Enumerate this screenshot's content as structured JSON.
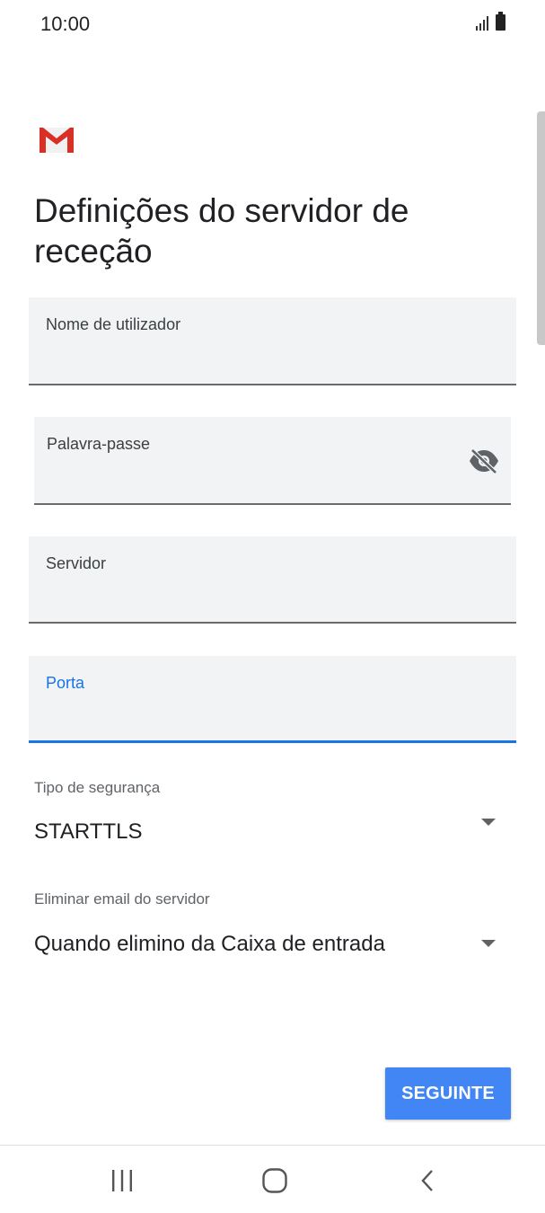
{
  "status_bar": {
    "time": "10:00"
  },
  "app": {
    "logo": "gmail-logo"
  },
  "page": {
    "title": "Definições do servidor de receção"
  },
  "fields": {
    "username": {
      "label": "Nome de utilizador",
      "value": ""
    },
    "password": {
      "label": "Palavra-passe",
      "value": ""
    },
    "server": {
      "label": "Servidor",
      "value": ""
    },
    "port": {
      "label": "Porta",
      "value": ""
    }
  },
  "security": {
    "label": "Tipo de segurança",
    "value": "STARTTLS"
  },
  "delete_email": {
    "label": "Eliminar email do servidor",
    "value": "Quando elimino da Caixa de entrada"
  },
  "next_button": {
    "label": "SEGUINTE"
  },
  "colors": {
    "accent": "#1a73e8",
    "button": "#4285f4",
    "field_bg": "#f1f3f4",
    "gmail_red": "#d93025"
  },
  "nav_icons": [
    "recents-icon",
    "home-icon",
    "back-icon"
  ]
}
